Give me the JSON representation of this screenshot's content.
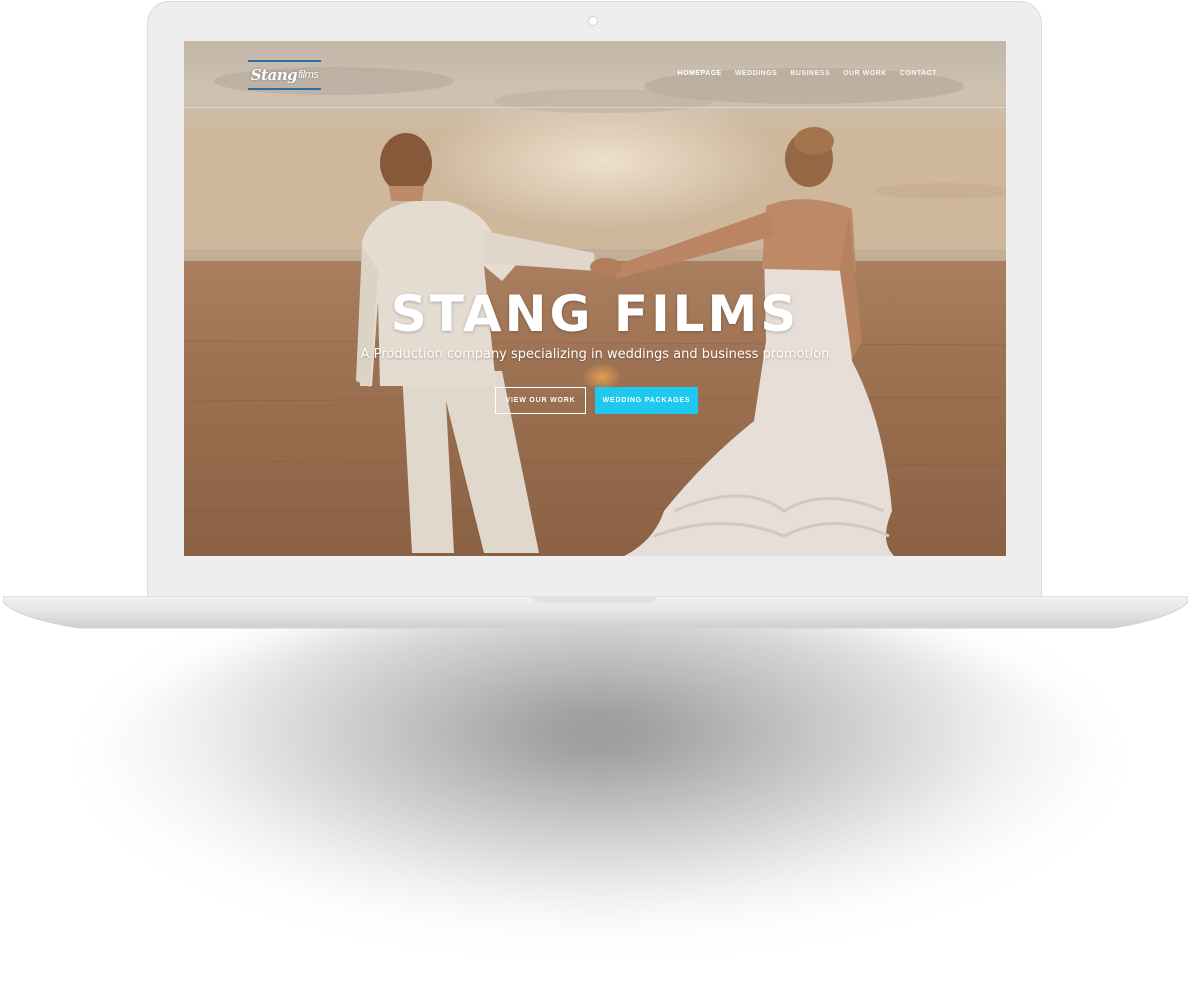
{
  "site": {
    "logo": {
      "main": "Stang",
      "small": "films"
    },
    "nav": {
      "items": [
        {
          "label": "HOMEPAGE",
          "active": true
        },
        {
          "label": "WEDDINGS",
          "active": false
        },
        {
          "label": "BUSINESS",
          "active": false
        },
        {
          "label": "OUR WORK",
          "active": false
        },
        {
          "label": "CONTACT",
          "active": false
        }
      ]
    },
    "hero": {
      "title": "STANG FILMS",
      "subtitle": "A Production company specializing in weddings and business promotion",
      "primary_button": "VIEW OUR WORK",
      "secondary_button": "WEDDING PACKAGES"
    }
  },
  "colors": {
    "accent": "#1ec8ee",
    "logo_rule": "#2a6fa3",
    "device_frame": "#eeeeee"
  }
}
